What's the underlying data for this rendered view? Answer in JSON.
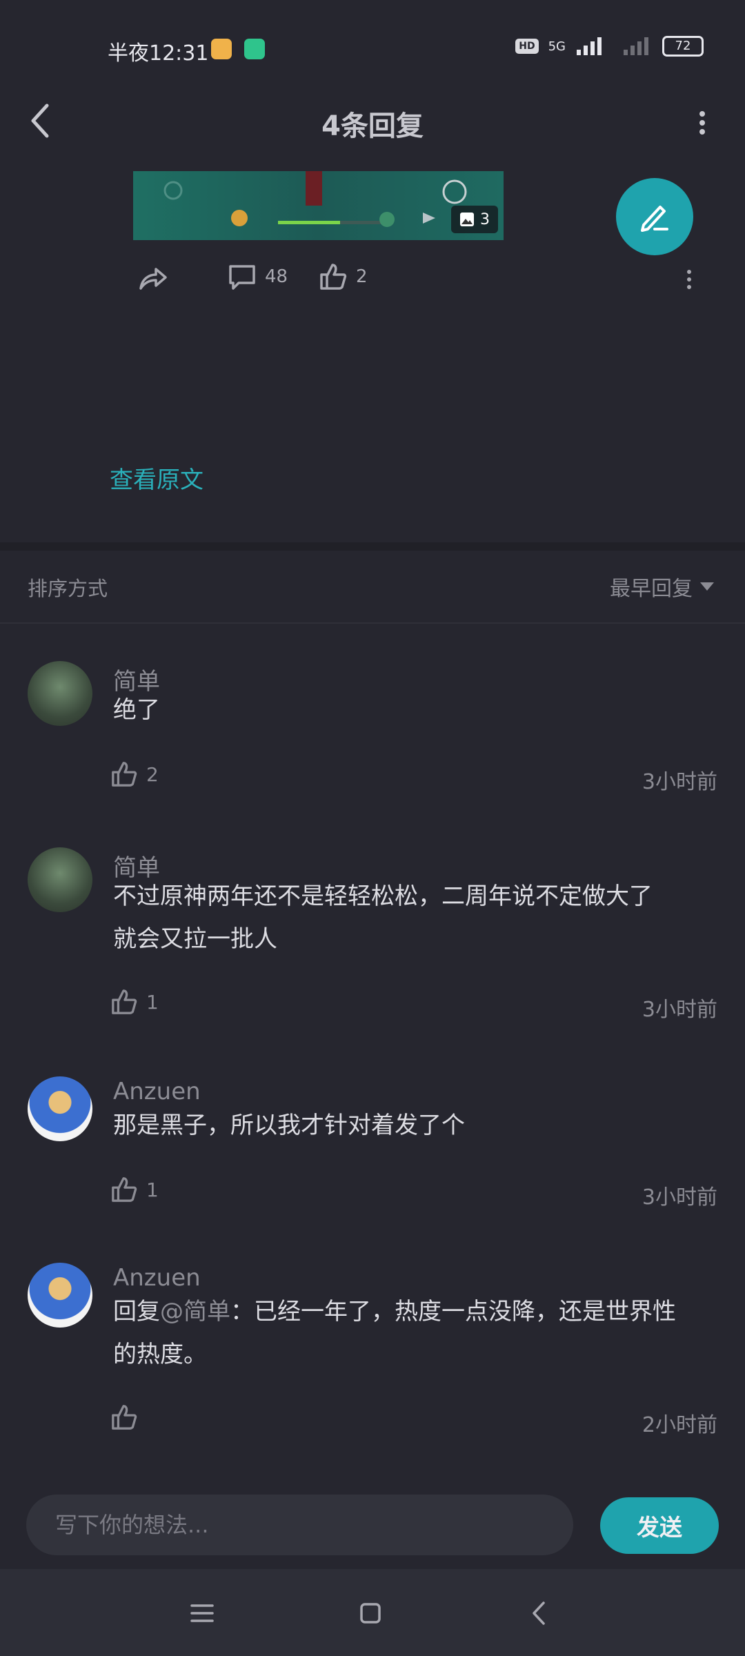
{
  "status": {
    "time": "半夜12:31",
    "hd": "HD",
    "network": "5G",
    "battery": "72"
  },
  "header": {
    "title": "4条回复"
  },
  "post": {
    "image_count": "3",
    "comments": "48",
    "likes": "2",
    "view_original": "查看原文"
  },
  "sort": {
    "label": "排序方式",
    "option": "最早回复"
  },
  "replies": [
    {
      "name": "简单",
      "text": "绝了",
      "likes": "2",
      "time": "3小时前"
    },
    {
      "name": "简单",
      "text_line1": "不过原神两年还不是轻轻松松，二周年说不定做大了",
      "text_line2": "就会又拉一批人",
      "likes": "1",
      "time": "3小时前"
    },
    {
      "name": "Anzuen",
      "text": "那是黑子，所以我才针对着发了个",
      "likes": "1",
      "time": "3小时前"
    },
    {
      "name": "Anzuen",
      "prefix": "回复",
      "mention": "@简单",
      "text_line1": "：已经一年了，热度一点没降，还是世界性",
      "text_line2": "的热度。",
      "likes": "",
      "time": "2小时前"
    }
  ],
  "composer": {
    "placeholder": "写下你的想法...",
    "send": "发送"
  },
  "colors": {
    "accent": "#1fa3ad",
    "background": "#26262f",
    "muted_text": "#8c8c94"
  }
}
